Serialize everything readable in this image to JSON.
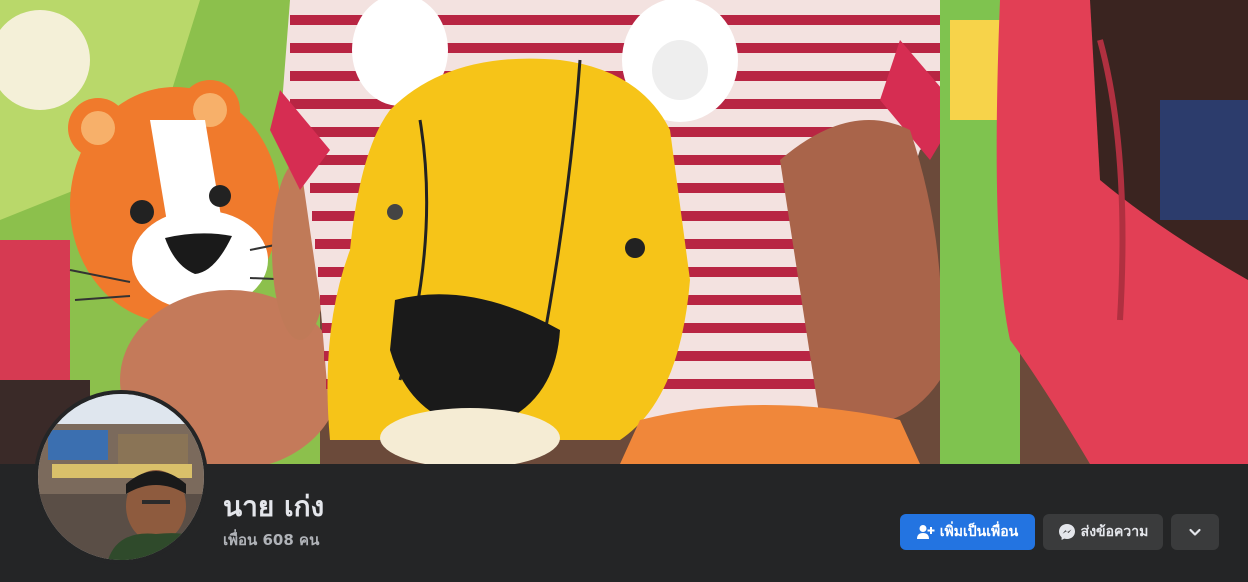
{
  "profile": {
    "name": "นาย เก่ง",
    "friends_text": "เพื่อน 608 คน"
  },
  "actions": {
    "add_friend_label": "เพิ่มเป็นเพื่อน",
    "message_label": "ส่งข้อความ",
    "more_icon": "chevron-down-icon"
  },
  "colors": {
    "background": "#242526",
    "primary_button": "#2374e1",
    "secondary_button": "#3a3b3c",
    "text_primary": "#e4e6eb",
    "text_secondary": "#b0b3b8"
  }
}
